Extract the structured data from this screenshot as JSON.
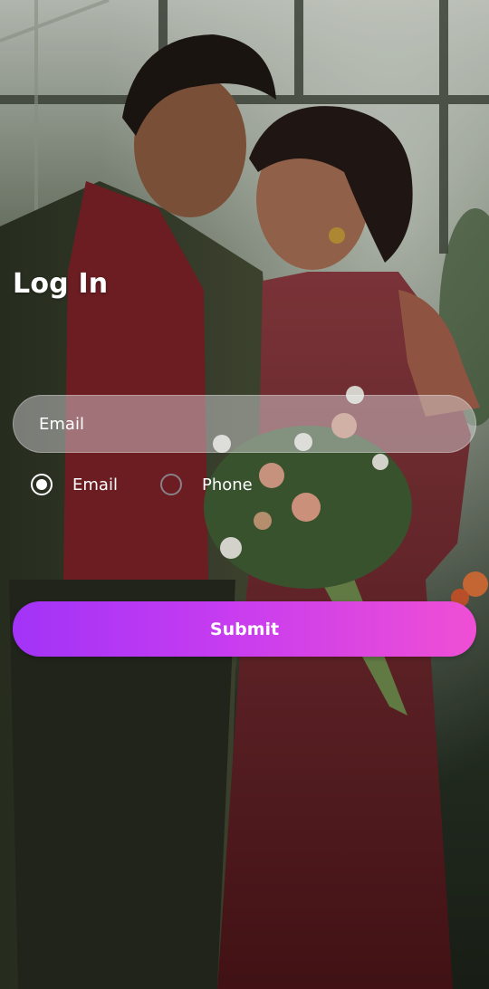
{
  "page": {
    "title": "Log In"
  },
  "form": {
    "input_placeholder": "Email",
    "input_value": "",
    "login_type": {
      "selected": "Email",
      "options": [
        {
          "label": "Email",
          "selected": true
        },
        {
          "label": "Phone",
          "selected": false
        }
      ]
    },
    "submit_label": "Submit"
  },
  "colors": {
    "accent_start": "#a233f7",
    "accent_end": "#ef4fd4",
    "text": "#ffffff"
  },
  "icons": {
    "radio_selected": "radio-selected-icon",
    "radio_unselected": "radio-unselected-icon"
  }
}
